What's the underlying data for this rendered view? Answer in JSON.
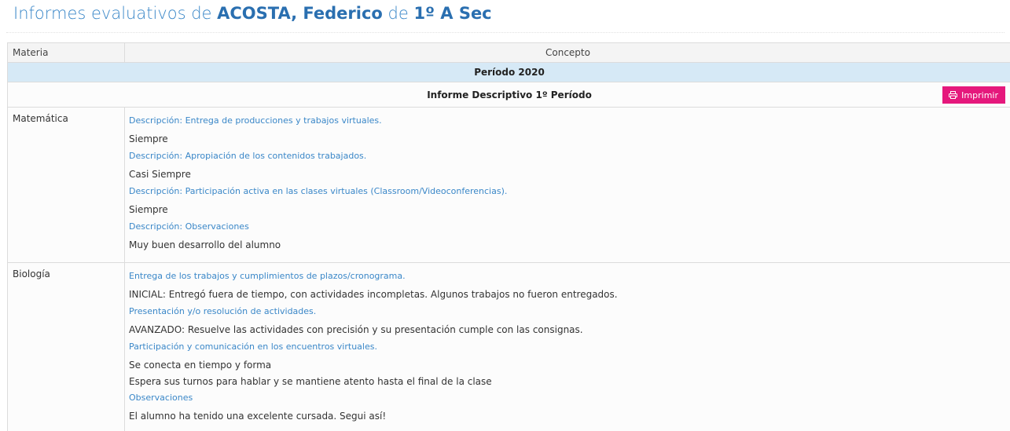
{
  "header": {
    "prefix": "Informes evaluativos de",
    "student": "ACOSTA, Federico",
    "connector": "de",
    "course": "1º A Sec"
  },
  "table": {
    "col_materia": "Materia",
    "col_concepto": "Concepto",
    "periodo": "Período 2020",
    "informe": "Informe Descriptivo 1º Período",
    "print_label": "Imprimir",
    "print_icon": "printer-icon",
    "subjects": [
      {
        "name": "Matemática",
        "items": [
          {
            "desc": "Descripción: Entrega de producciones y trabajos virtuales.",
            "values": [
              "Siempre"
            ]
          },
          {
            "desc": "Descripción: Apropiación de los contenidos trabajados.",
            "values": [
              "Casi Siempre"
            ]
          },
          {
            "desc": "Descripción: Participación activa en las clases virtuales (Classroom/Videoconferencias).",
            "values": [
              "Siempre"
            ]
          },
          {
            "desc": "Descripción: Observaciones",
            "values": [
              "Muy buen desarrollo del alumno"
            ]
          }
        ]
      },
      {
        "name": "Biología",
        "items": [
          {
            "desc": "Entrega de los trabajos y cumplimientos de plazos/cronograma.",
            "values": [
              "INICIAL: Entregó fuera de tiempo, con actividades incompletas. Algunos trabajos no fueron entregados."
            ]
          },
          {
            "desc": "Presentación y/o resolución de actividades.",
            "values": [
              "AVANZADO: Resuelve las actividades con precisión y su presentación cumple con las consignas."
            ]
          },
          {
            "desc": "Participación y comunicación en los encuentros virtuales.",
            "values": [
              "Se conecta en tiempo y forma",
              "Espera sus turnos para hablar y se mantiene atento hasta el final de la clase"
            ]
          },
          {
            "desc": "Observaciones",
            "values": [
              "El alumno ha tenido una excelente cursada. Segui así!"
            ]
          }
        ]
      }
    ]
  },
  "colors": {
    "title": "#3a87c8",
    "periodo_bg": "#d6e9f6",
    "print_button": "#e5187c"
  }
}
